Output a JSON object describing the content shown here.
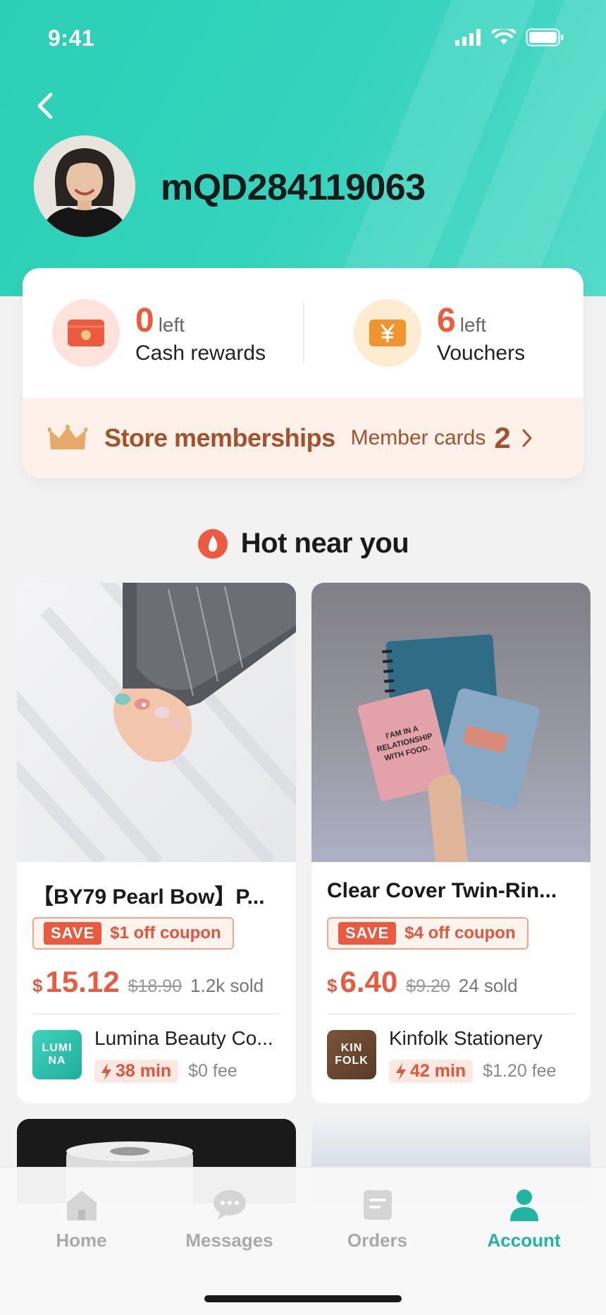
{
  "status": {
    "time": "9:41"
  },
  "profile": {
    "username": "mQD284119063"
  },
  "rewards": [
    {
      "count": "0",
      "left_label": "left",
      "label": "Cash rewards"
    },
    {
      "count": "6",
      "left_label": "left",
      "label": "Vouchers"
    }
  ],
  "membership": {
    "title": "Store memberships",
    "sub_label": "Member cards",
    "count": "2"
  },
  "section": {
    "title": "Hot near you"
  },
  "products": [
    {
      "name": "【BY79 Pearl Bow】P...",
      "coupon_tag": "SAVE",
      "coupon_text": "$1 off coupon",
      "currency": "$",
      "price": "15.12",
      "old_price": "$18.90",
      "sold": "1.2k sold",
      "store_logo": "LUMI NA",
      "store_name": "Lumina Beauty Co...",
      "eta": "38 min",
      "fee": "$0 fee"
    },
    {
      "name": "Clear Cover Twin-Rin...",
      "coupon_tag": "SAVE",
      "coupon_text": "$4 off coupon",
      "currency": "$",
      "price": "6.40",
      "old_price": "$9.20",
      "sold": "24 sold",
      "store_logo": "KIN FOLK",
      "store_name": "Kinfolk Stationery",
      "eta": "42 min",
      "fee": "$1.20 fee"
    }
  ],
  "tabbar": {
    "items": [
      {
        "label": "Home",
        "icon": "home-icon"
      },
      {
        "label": "Messages",
        "icon": "chat-bubble-icon"
      },
      {
        "label": "Orders",
        "icon": "orders-icon"
      },
      {
        "label": "Account",
        "icon": "person-icon"
      }
    ],
    "active": "Account"
  },
  "colors": {
    "brand": "#2ccfb6",
    "accent": "#ea5a3f",
    "membership": "#a4512c",
    "active_tab": "#20b5a0"
  }
}
